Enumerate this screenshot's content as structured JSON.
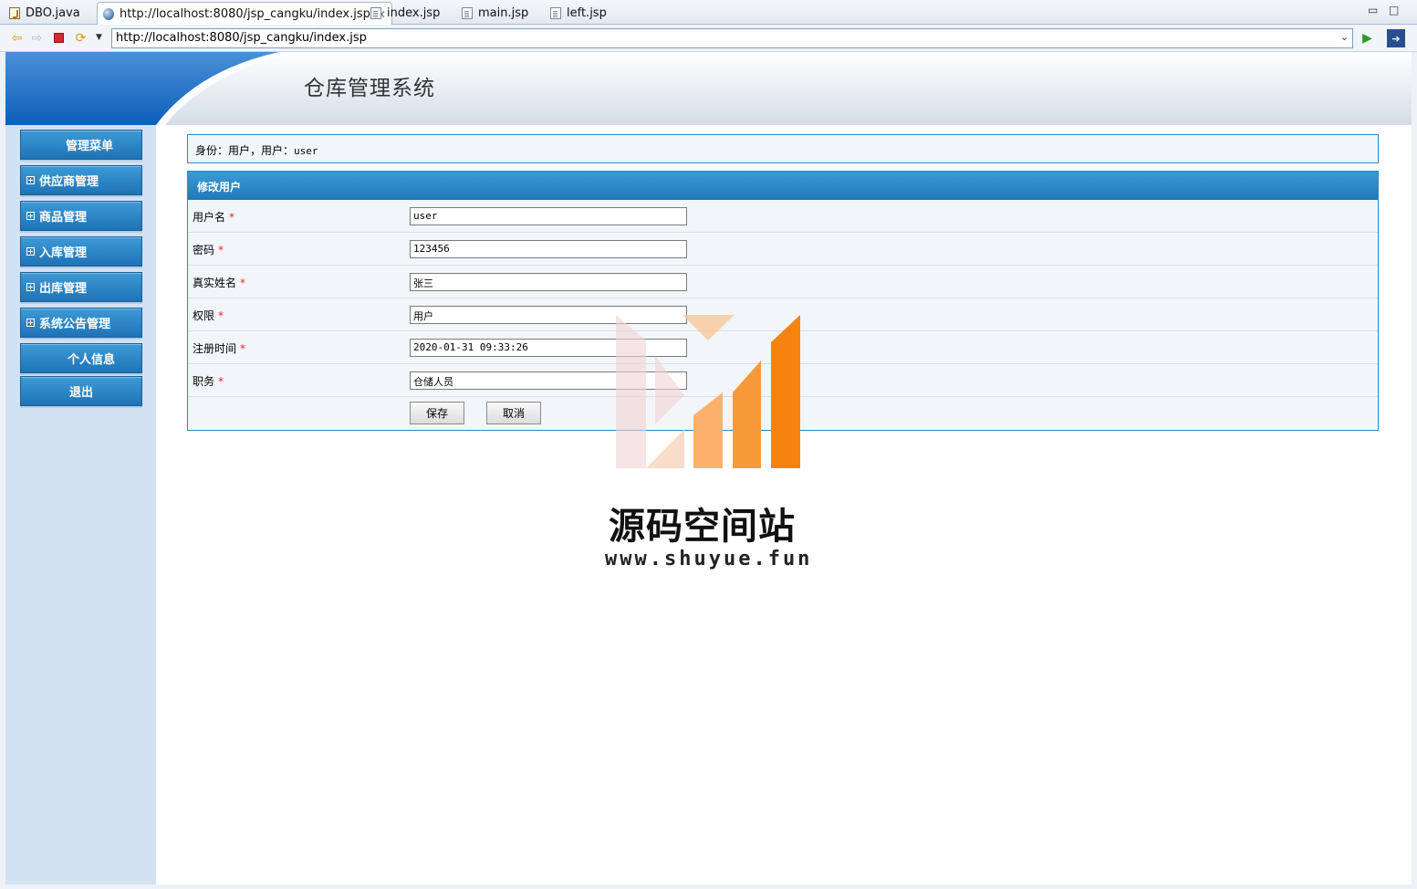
{
  "tabs": [
    {
      "label": "DBO.java",
      "icon": "java-file-icon"
    },
    {
      "label": "http://localhost:8080/jsp_cangku/index.jsp",
      "icon": "globe-icon",
      "active": true
    },
    {
      "label": "index.jsp",
      "icon": "jsp-file-icon"
    },
    {
      "label": "main.jsp",
      "icon": "jsp-file-icon"
    },
    {
      "label": "left.jsp",
      "icon": "jsp-file-icon"
    }
  ],
  "address": {
    "url": "http://localhost:8080/jsp_cangku/index.jsp"
  },
  "header": {
    "title": "仓库管理系统"
  },
  "sidebar": {
    "heading": "管理菜单",
    "items": [
      {
        "label": "供应商管理",
        "expandable": true
      },
      {
        "label": "商品管理",
        "expandable": true
      },
      {
        "label": "入库管理",
        "expandable": true
      },
      {
        "label": "出库管理",
        "expandable": true
      },
      {
        "label": "系统公告管理",
        "expandable": true
      },
      {
        "label": "个人信息",
        "expandable": false
      },
      {
        "label": "退出",
        "expandable": false
      }
    ]
  },
  "identity": {
    "prefix": "身份：用户，用户：",
    "user": "user"
  },
  "form": {
    "title": "修改用户",
    "fields": [
      {
        "label": "用户名",
        "value": "user"
      },
      {
        "label": "密码",
        "value": "123456"
      },
      {
        "label": "真实姓名",
        "value": "张三"
      },
      {
        "label": "权限",
        "value": "用户"
      },
      {
        "label": "注册时间",
        "value": "2020-01-31 09:33:26"
      },
      {
        "label": "职务",
        "value": "仓储人员"
      }
    ],
    "required_mark": "*",
    "save_label": "保存",
    "cancel_label": "取消"
  },
  "watermark": {
    "name": "源码空间站",
    "url": "www.shuyue.fun"
  },
  "colors": {
    "accent": "#2078b9",
    "required": "#e0292e",
    "sidebar_bg": "#d2e2f2"
  }
}
